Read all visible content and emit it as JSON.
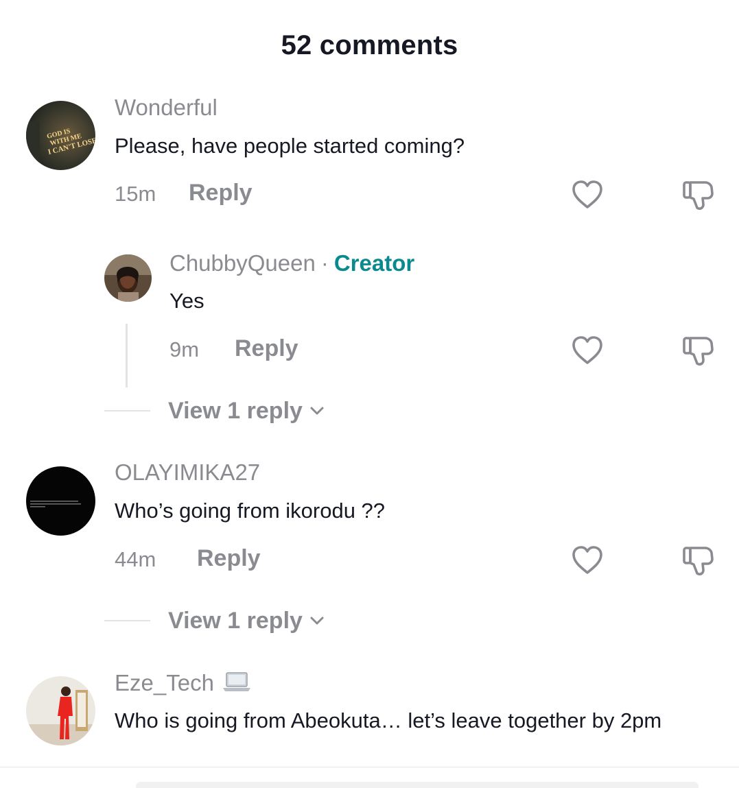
{
  "header": {
    "title": "52 comments"
  },
  "comments": [
    {
      "username": "Wonderful",
      "avatar_text": "GOD IS WITH ME I CAN'T LOSE",
      "text": "Please, have people started coming?",
      "time": "15m",
      "reply_label": "Reply",
      "replies": [
        {
          "username": "ChubbyQueen",
          "separator": "·",
          "badge": "Creator",
          "text": "Yes",
          "time": "9m",
          "reply_label": "Reply"
        }
      ],
      "view_replies_label": "View 1 reply"
    },
    {
      "username": "OLAYIMIKA27",
      "avatar_text": "After certain things happen, you don't feel the same way about people anymore, no matter who they are.",
      "text": "Who’s going from ikorodu ??",
      "time": "44m",
      "reply_label": "Reply",
      "view_replies_label": "View 1 reply"
    },
    {
      "username": "Eze_Tech",
      "username_icon": "laptop-icon",
      "text": "Who is going from Abeokuta… let’s leave together by 2pm"
    }
  ],
  "icons": {
    "like": "heart-outline-icon",
    "dislike": "thumbs-down-outline-icon",
    "expand": "chevron-down-icon"
  },
  "colors": {
    "text_primary": "#161823",
    "text_secondary": "#8a8b91",
    "creator_accent": "#0a8a8f",
    "divider": "#e3e3e4"
  }
}
